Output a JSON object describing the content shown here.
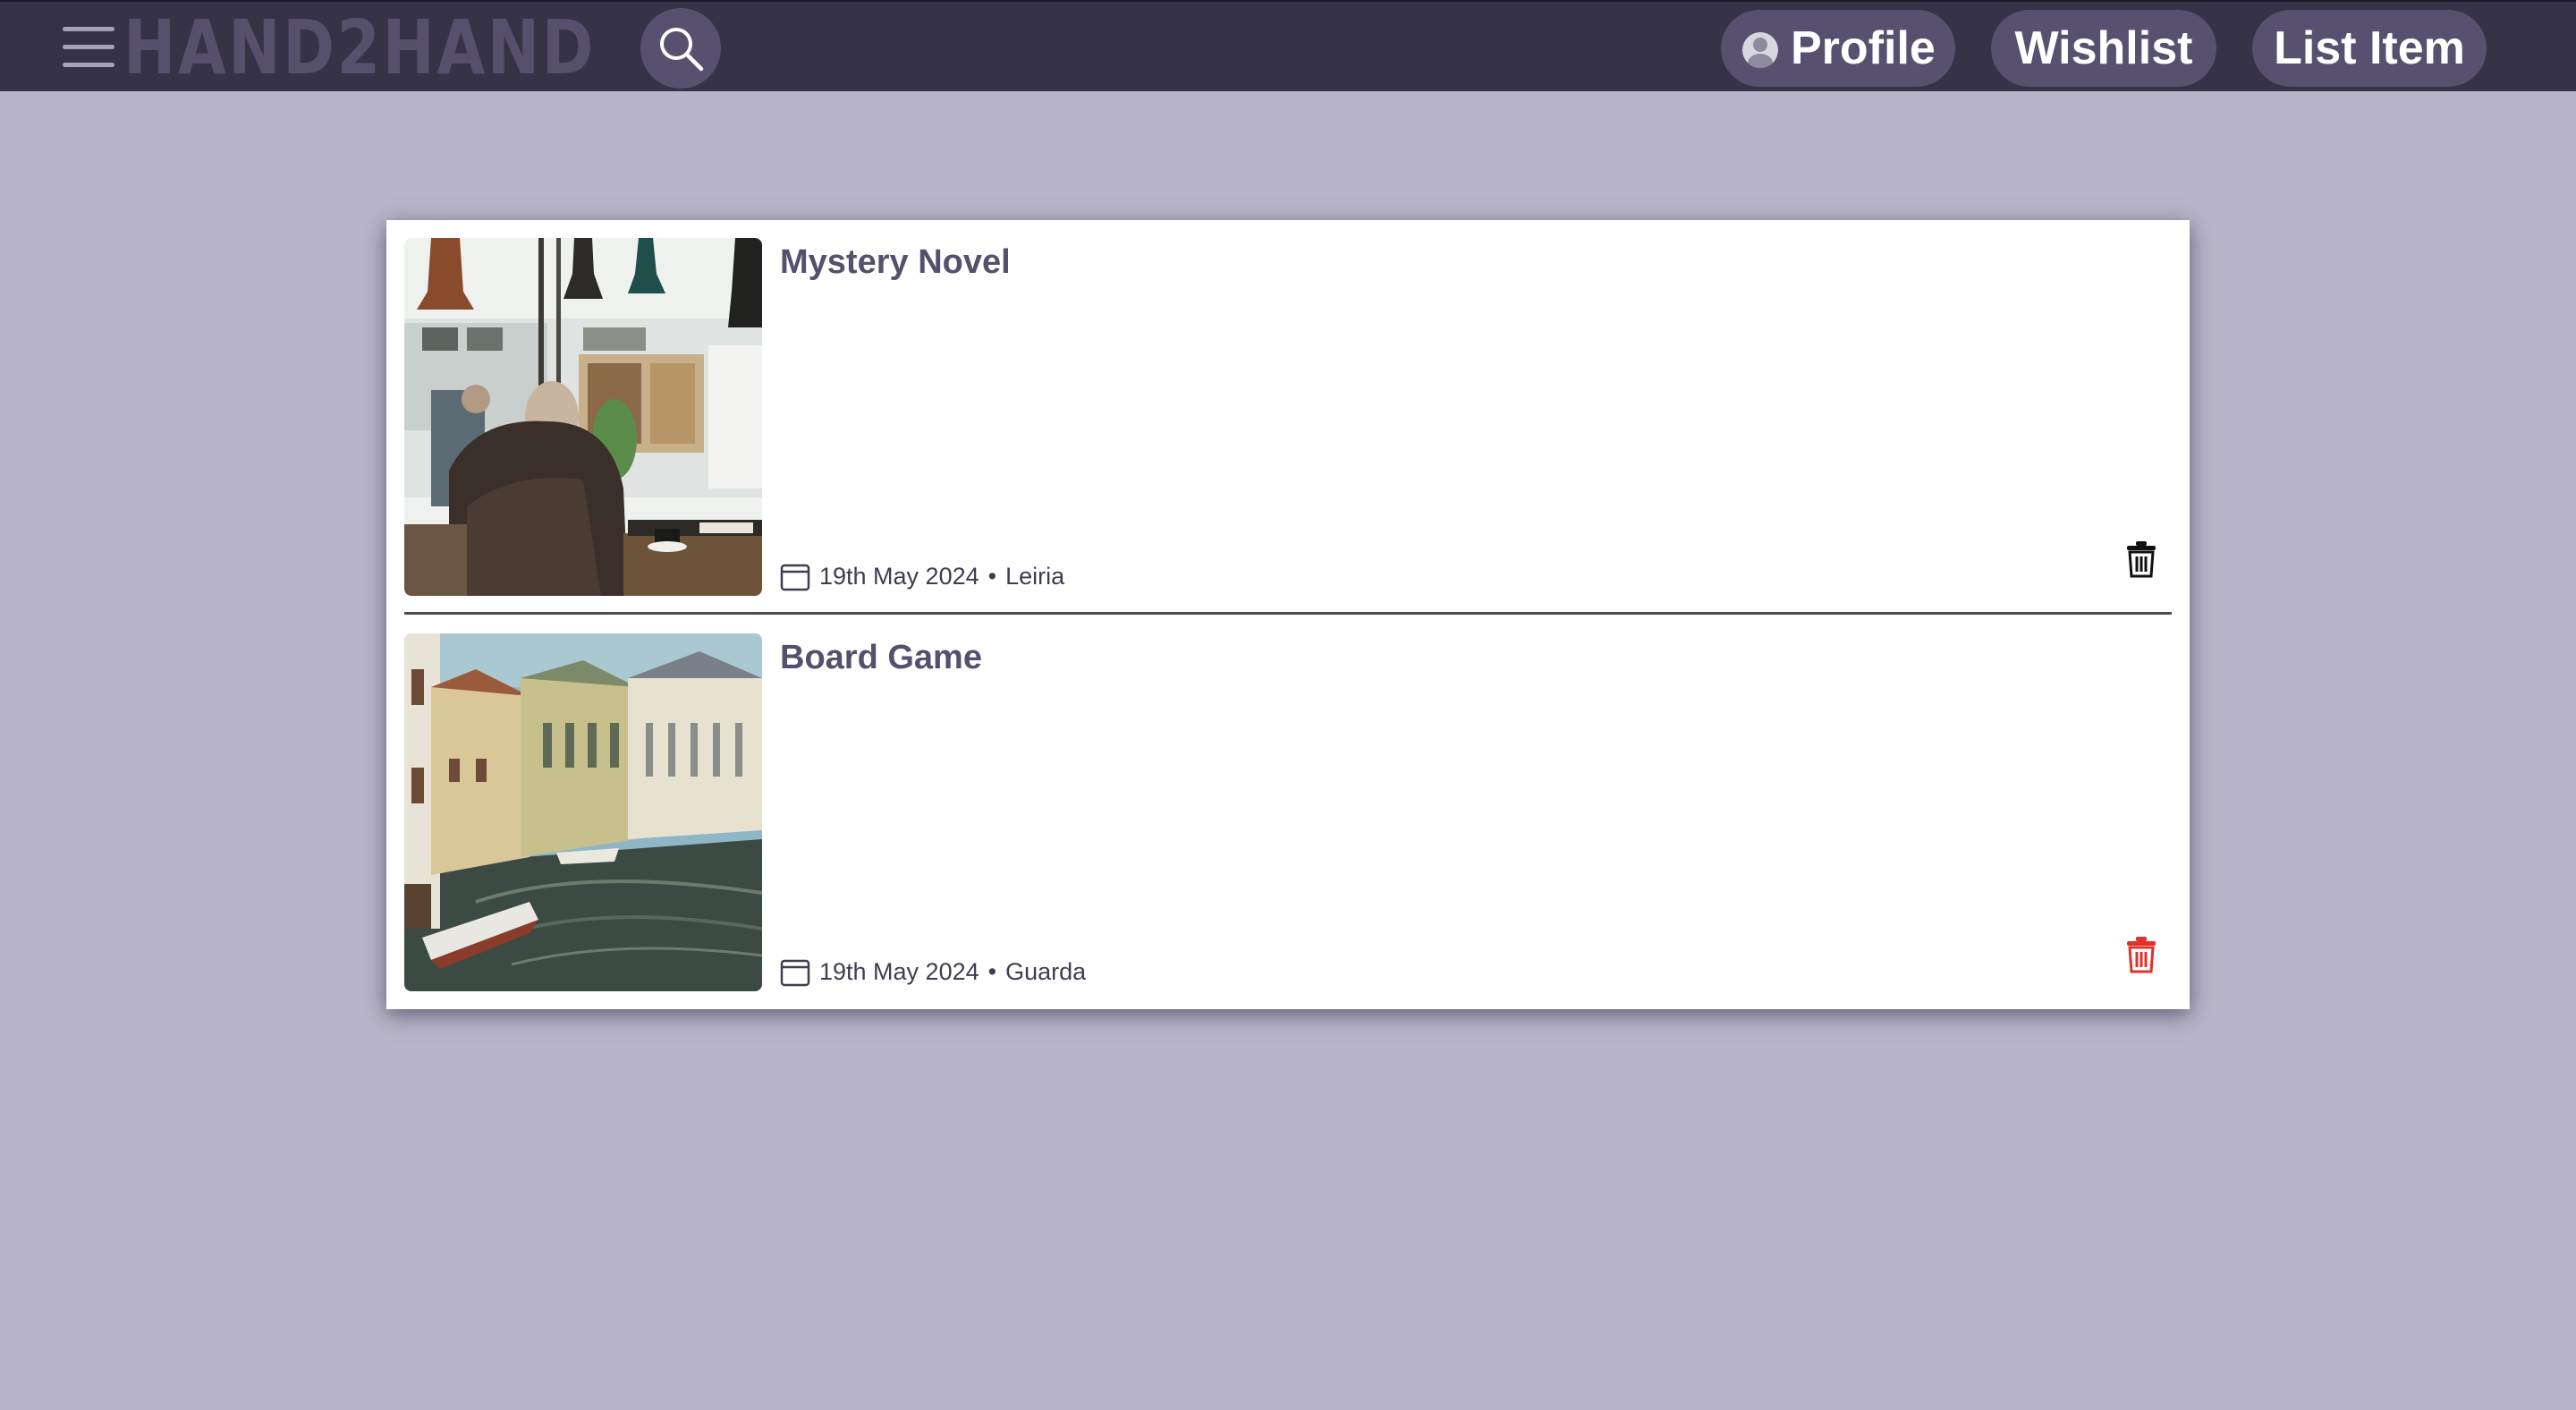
{
  "header": {
    "logo": "HAND2HAND",
    "menu_icon": "hamburger-menu-icon",
    "search_icon": "search-icon",
    "nav": {
      "profile": "Profile",
      "wishlist": "Wishlist",
      "list_item": "List Item"
    },
    "colors": {
      "bar": "#363247",
      "pill": "#57516f",
      "logo": "#56506d"
    }
  },
  "page": {
    "background": "#b8b5c8"
  },
  "items": [
    {
      "title": "Mystery Novel",
      "date": "19th May 2024",
      "separator": "•",
      "location": "Leiria",
      "image": "photo-cafe-man-reading",
      "date_icon": "calendar-icon",
      "delete_icon": "trash-icon",
      "delete_color": "#111111"
    },
    {
      "title": "Board Game",
      "date": "19th May 2024",
      "separator": "•",
      "location": "Guarda",
      "image": "photo-canal-houses-boats",
      "date_icon": "calendar-icon",
      "delete_icon": "trash-icon",
      "delete_color": "#e0322b"
    }
  ]
}
